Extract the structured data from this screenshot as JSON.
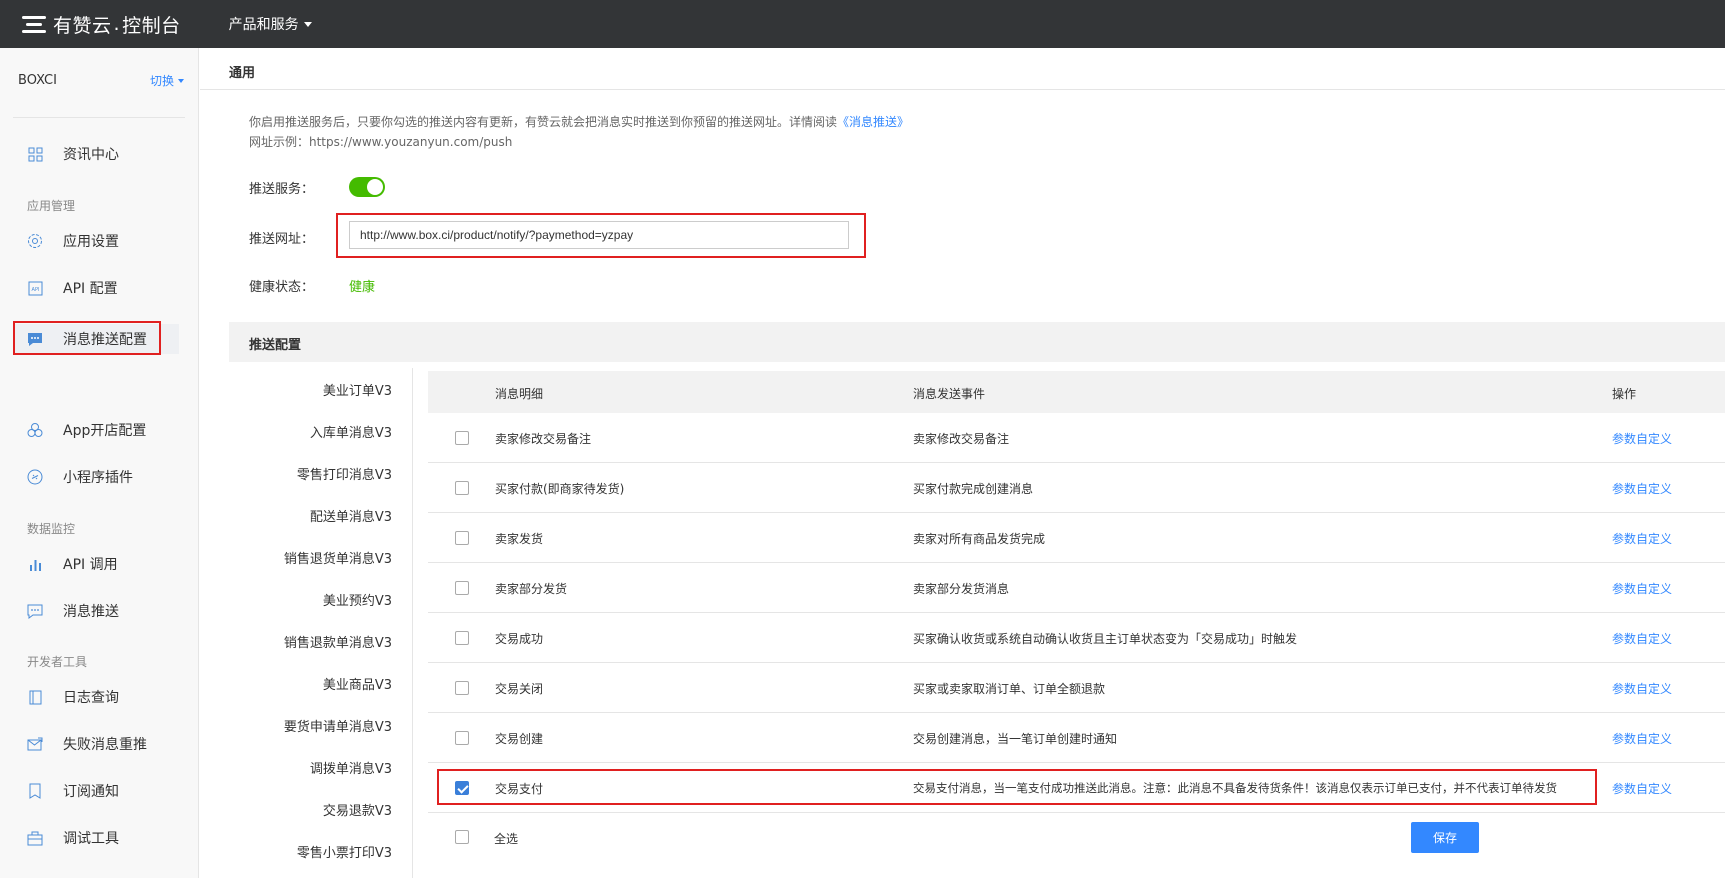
{
  "topbar": {
    "logo_text": "有赞云",
    "logo_dot": ".",
    "logo_suffix": "控制台",
    "products_label": "产品和服务"
  },
  "sidebar": {
    "account_name": "BOXCI",
    "switch_label": "切换",
    "items": {
      "news": "资讯中心",
      "app_settings": "应用设置",
      "api_config": "API 配置",
      "push_config": "消息推送配置",
      "app_store": "App开店配置",
      "mini_plugin": "小程序插件",
      "api_call": "API 调用",
      "msg_push": "消息推送",
      "log_query": "日志查询",
      "fail_retry": "失败消息重推",
      "subscribe": "订阅通知",
      "debug_tool": "调试工具"
    },
    "groups": {
      "app_manage": "应用管理",
      "data_monitor": "数据监控",
      "dev_tools": "开发者工具"
    }
  },
  "general": {
    "title": "通用",
    "desc_line1": "你启用推送服务后，只要你勾选的推送内容有更新，有赞云就会把消息实时推送到你预留的推送网址。详情阅读",
    "desc_link": "《消息推送》",
    "desc_line2": "网址示例：https://www.youzanyun.com/push",
    "service_label": "推送服务：",
    "url_label": "推送网址：",
    "url_value": "http://www.box.ci/product/notify/?paymethod=yzpay",
    "health_label": "健康状态：",
    "health_value": "健康",
    "toggle_on": true
  },
  "push_config": {
    "title": "推送配置",
    "categories": [
      "美业订单V3",
      "入库单消息V3",
      "零售打印消息V3",
      "配送单消息V3",
      "销售退货单消息V3",
      "美业预约V3",
      "销售退款单消息V3",
      "美业商品V3",
      "要货申请单消息V3",
      "调拨单消息V3",
      "交易退款V3",
      "零售小票打印V3"
    ],
    "columns": {
      "detail": "消息明细",
      "event": "消息发送事件",
      "action": "操作"
    },
    "rows": [
      {
        "checked": false,
        "detail": "卖家修改交易备注",
        "event": "卖家修改交易备注",
        "action": "参数自定义"
      },
      {
        "checked": false,
        "detail": "买家付款(即商家待发货)",
        "event": "买家付款完成创建消息",
        "action": "参数自定义"
      },
      {
        "checked": false,
        "detail": "卖家发货",
        "event": "卖家对所有商品发货完成",
        "action": "参数自定义"
      },
      {
        "checked": false,
        "detail": "卖家部分发货",
        "event": "卖家部分发货消息",
        "action": "参数自定义"
      },
      {
        "checked": false,
        "detail": "交易成功",
        "event": "买家确认收货或系统自动确认收货且主订单状态变为「交易成功」时触发",
        "action": "参数自定义"
      },
      {
        "checked": false,
        "detail": "交易关闭",
        "event": "买家或卖家取消订单、订单全额退款",
        "action": "参数自定义"
      },
      {
        "checked": false,
        "detail": "交易创建",
        "event": "交易创建消息，当一笔订单创建时通知",
        "action": "参数自定义"
      },
      {
        "checked": true,
        "detail": "交易支付",
        "event": "交易支付消息，当一笔支付成功推送此消息。注意：此消息不具备发待货条件！该消息仅表示订单已支付，并不代表订单待发货",
        "action": "参数自定义"
      }
    ],
    "select_all": "全选",
    "save": "保存"
  },
  "colors": {
    "topbar": "#333537",
    "accent": "#3388ff",
    "success": "#44bb00",
    "highlight": "#e02020"
  }
}
